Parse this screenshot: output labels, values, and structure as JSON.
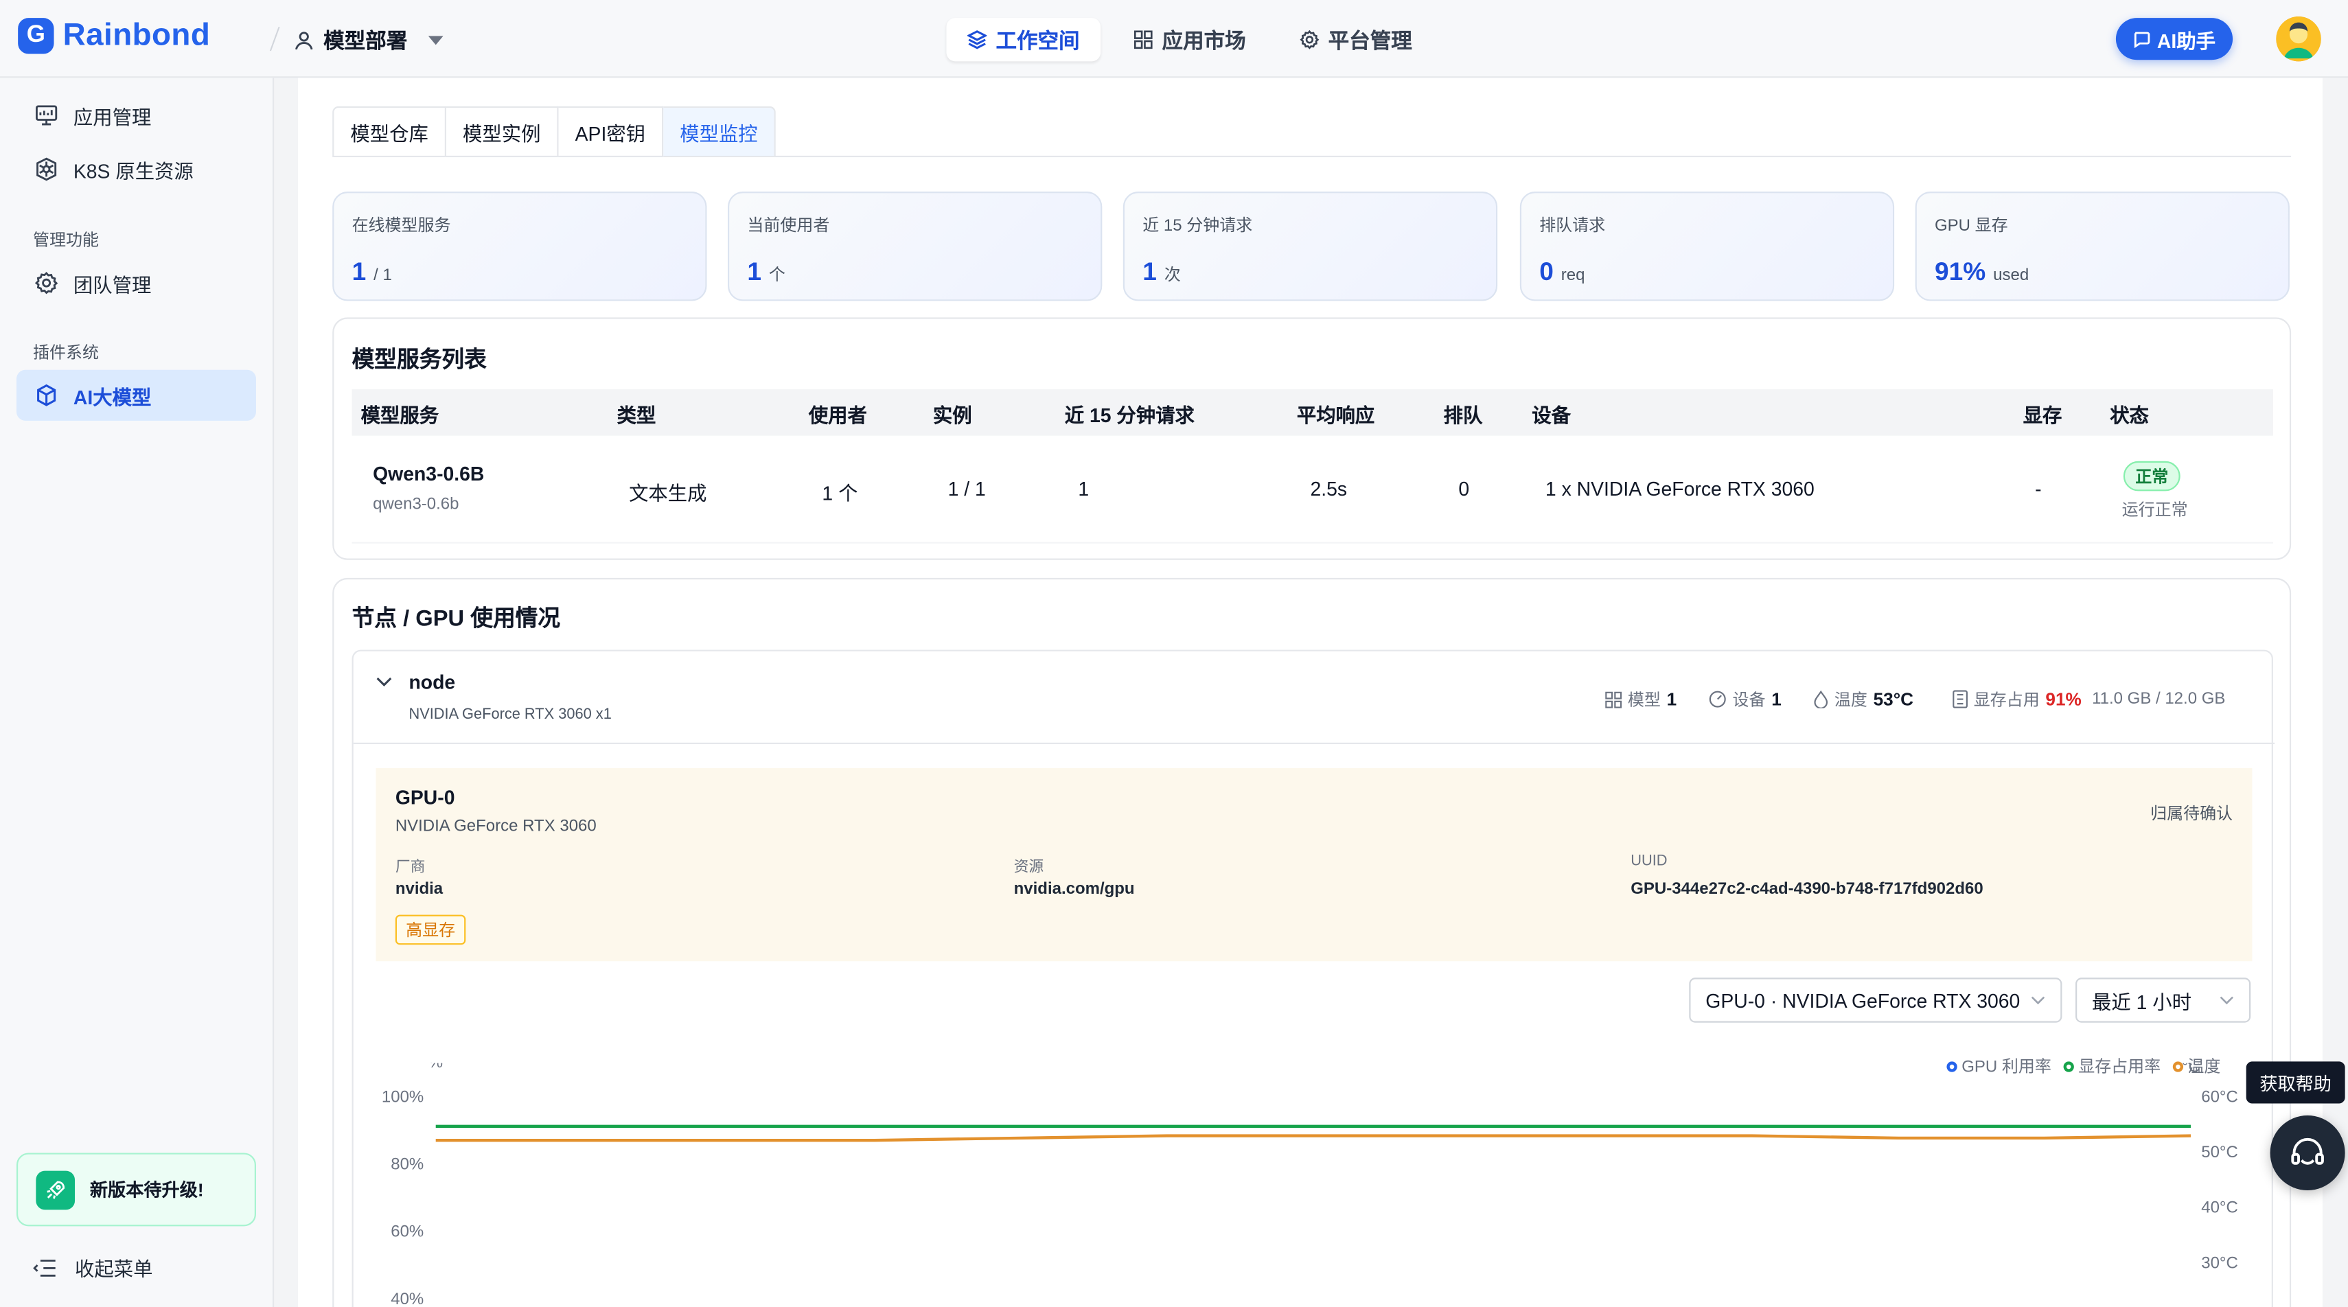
{
  "app": {
    "logo_text": "Rainbond",
    "logo_letter": "G"
  },
  "workspace": {
    "name": "模型部署"
  },
  "nav": {
    "items": [
      {
        "label": "工作空间",
        "icon": "layers-icon",
        "active": true
      },
      {
        "label": "应用市场",
        "icon": "grid-icon"
      },
      {
        "label": "平台管理",
        "icon": "gear-icon"
      }
    ]
  },
  "ai_button": {
    "label": "AI助手"
  },
  "sidebar": {
    "items": [
      {
        "label": "应用管理",
        "icon": "monitor-icon"
      },
      {
        "label": "K8S 原生资源",
        "icon": "kubernetes-icon"
      }
    ],
    "group_manage": "管理功能",
    "manage_items": [
      {
        "label": "团队管理",
        "icon": "gear-icon"
      }
    ],
    "group_plugin": "插件系统",
    "plugin_items": [
      {
        "label": "AI大模型",
        "icon": "cube-icon",
        "active": true
      }
    ],
    "upgrade": "新版本待升级!",
    "collapse": "收起菜单"
  },
  "tabs": [
    {
      "label": "模型仓库"
    },
    {
      "label": "模型实例"
    },
    {
      "label": "API密钥"
    },
    {
      "label": "模型监控",
      "active": true
    }
  ],
  "stats": [
    {
      "label": "在线模型服务",
      "value": "1",
      "unit": "/ 1"
    },
    {
      "label": "当前使用者",
      "value": "1",
      "unit": "个"
    },
    {
      "label": "近 15 分钟请求",
      "value": "1",
      "unit": "次"
    },
    {
      "label": "排队请求",
      "value": "0",
      "unit": "req"
    },
    {
      "label": "GPU 显存",
      "value": "91%",
      "unit": "used"
    }
  ],
  "service_list": {
    "title": "模型服务列表",
    "headers": [
      "模型服务",
      "类型",
      "使用者",
      "实例",
      "近 15 分钟请求",
      "平均响应",
      "排队",
      "设备",
      "显存",
      "状态"
    ],
    "rows": [
      {
        "name": "Qwen3-0.6B",
        "id": "qwen3-0.6b",
        "type": "文本生成",
        "users": "1 个",
        "instances": "1 / 1",
        "requests": "1",
        "avg_response": "2.5s",
        "queue": "0",
        "device": "1 x NVIDIA GeForce RTX 3060",
        "memory": "-",
        "status": "正常",
        "status_text": "运行正常"
      }
    ]
  },
  "gpu_usage": {
    "title": "节点 / GPU 使用情况",
    "node": {
      "name": "node",
      "subtitle": "NVIDIA GeForce RTX 3060 x1",
      "models_label": "模型",
      "models": "1",
      "devices_label": "设备",
      "devices": "1",
      "temp_label": "温度",
      "temp": "53°C",
      "mem_label": "显存占用",
      "mem_pct": "91%",
      "mem_detail": "11.0 GB / 12.0 GB"
    },
    "gpu": {
      "name": "GPU-0",
      "model": "NVIDIA GeForce RTX 3060",
      "ownership": "归属待确认",
      "vendor_label": "厂商",
      "vendor": "nvidia",
      "resource_label": "资源",
      "resource": "nvidia.com/gpu",
      "uuid_label": "UUID",
      "uuid": "GPU-344e27c2-c4ad-4390-b748-f717fd902d60",
      "tag": "高显存"
    },
    "gpu_select": "GPU-0 · NVIDIA GeForce RTX 3060",
    "range_select": "最近 1 小时"
  },
  "help": {
    "tooltip": "获取帮助"
  },
  "colors": {
    "accent": "#2563eb",
    "gpu_util": "#2563eb",
    "mem_usage": "#16a34a",
    "temperature": "#e3912d",
    "danger": "#dc2626"
  },
  "chart_data": {
    "type": "line",
    "legend": [
      "GPU 利用率",
      "显存占用率",
      "温度"
    ],
    "legend_position": "top-right",
    "y_left_label": "%",
    "y_right_label": "°C",
    "y_left_ticks": [
      "100%",
      "80%",
      "60%",
      "40%"
    ],
    "y_right_ticks": [
      "60°C",
      "50°C",
      "40°C",
      "30°C"
    ],
    "ylim_left": [
      40,
      100
    ],
    "ylim_right": [
      30,
      60
    ],
    "series": [
      {
        "name": "显存占用率",
        "axis": "left",
        "values": [
          91,
          91,
          91,
          91,
          91,
          91,
          91,
          91,
          91,
          91,
          91,
          91,
          91
        ]
      },
      {
        "name": "温度",
        "axis": "right",
        "values": [
          52,
          52,
          52,
          52,
          52.4,
          52.8,
          52.8,
          52.8,
          52.8,
          52.8,
          52.4,
          52.4,
          52.8
        ]
      }
    ],
    "grid": false
  }
}
